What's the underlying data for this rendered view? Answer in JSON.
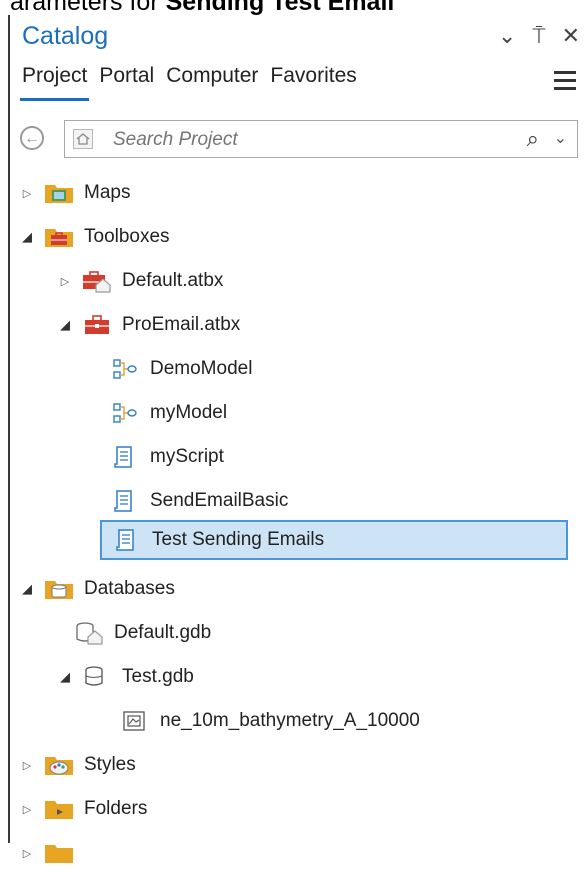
{
  "topcut": {
    "prefix": "arameters for ",
    "bold": "Sending Test Email"
  },
  "panel": {
    "title": "Catalog",
    "controls": {
      "dropdown": "⌄",
      "pin": "⍑",
      "close": "✕"
    },
    "tabs": [
      "Project",
      "Portal",
      "Computer",
      "Favorites"
    ],
    "active_tab": "Project",
    "search": {
      "placeholder": "Search Project",
      "value": ""
    },
    "tree": [
      {
        "label": "Maps",
        "state": "collapsed",
        "icon": "maps-folder-icon"
      },
      {
        "label": "Toolboxes",
        "state": "expanded",
        "icon": "toolboxes-folder-icon"
      },
      {
        "label": "Default.atbx",
        "state": "collapsed",
        "icon": "default-toolbox-icon"
      },
      {
        "label": "ProEmail.atbx",
        "state": "expanded",
        "icon": "toolbox-icon"
      },
      {
        "label": "DemoModel",
        "icon": "model-icon"
      },
      {
        "label": "myModel",
        "icon": "model-icon"
      },
      {
        "label": "myScript",
        "icon": "script-icon"
      },
      {
        "label": "SendEmailBasic",
        "icon": "script-icon"
      },
      {
        "label": "Test Sending Emails",
        "icon": "script-icon",
        "selected": true
      },
      {
        "label": "Databases",
        "state": "expanded",
        "icon": "databases-folder-icon"
      },
      {
        "label": "Default.gdb",
        "icon": "default-geodatabase-icon"
      },
      {
        "label": "Test.gdb",
        "state": "expanded",
        "icon": "geodatabase-icon"
      },
      {
        "label": "ne_10m_bathymetry_A_10000",
        "icon": "raster-icon"
      },
      {
        "label": "Styles",
        "state": "collapsed",
        "icon": "styles-folder-icon"
      },
      {
        "label": "Folders",
        "state": "collapsed",
        "icon": "folders-folder-icon"
      }
    ]
  },
  "colors": {
    "accent": "#1a6ec0",
    "selection_bg": "#cde3f6",
    "selection_border": "#4a96d8",
    "folder": "#e8a523"
  }
}
